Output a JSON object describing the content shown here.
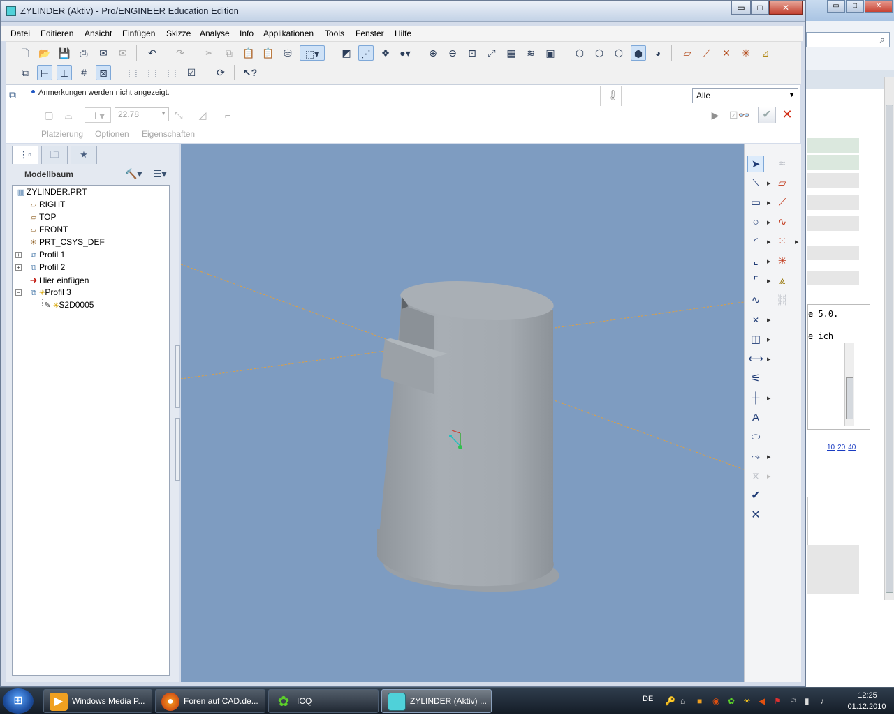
{
  "window": {
    "title": "ZYLINDER (Aktiv) - Pro/ENGINEER Education Edition",
    "min_glyph": "▭",
    "max_glyph": "□",
    "close_glyph": "✕"
  },
  "menu": [
    "Datei",
    "Editieren",
    "Ansicht",
    "Einfügen",
    "Skizze",
    "Analyse",
    "Info",
    "Applikationen",
    "Tools",
    "Fenster",
    "Hilfe"
  ],
  "dashboard": {
    "status_message": "Anmerkungen werden nicht angezeigt.",
    "filter_value": "Alle",
    "depth_value": "22.78",
    "tabs": [
      "Platzierung",
      "Optionen",
      "Eigenschaften"
    ]
  },
  "model_tree": {
    "header": "Modellbaum",
    "items": [
      {
        "label": "ZYLINDER.PRT",
        "icon": "part-icon"
      },
      {
        "label": "RIGHT",
        "icon": "datum-plane-icon"
      },
      {
        "label": "TOP",
        "icon": "datum-plane-icon"
      },
      {
        "label": "FRONT",
        "icon": "datum-plane-icon"
      },
      {
        "label": "PRT_CSYS_DEF",
        "icon": "coordinate-system-icon"
      },
      {
        "label": "Profil 1",
        "icon": "extrude-icon"
      },
      {
        "label": "Profil 2",
        "icon": "extrude-icon"
      },
      {
        "label": "Hier einfügen",
        "icon": "insert-here-arrow-icon"
      },
      {
        "label": "Profil 3",
        "icon": "extrude-icon"
      },
      {
        "label": "S2D0005",
        "icon": "sketch-icon"
      }
    ]
  },
  "background_window": {
    "code_lines": [
      "e 5.0.",
      "e ich"
    ],
    "pager": [
      "10",
      "20",
      "40"
    ]
  },
  "taskbar": {
    "items": [
      {
        "label": "Windows Media P...",
        "icon": "media-player-icon"
      },
      {
        "label": "Foren auf CAD.de...",
        "icon": "firefox-icon"
      },
      {
        "label": "ICQ",
        "icon": "icq-flower-icon"
      },
      {
        "label": "ZYLINDER (Aktiv) ...",
        "icon": "proe-icon"
      }
    ],
    "language": "DE",
    "time": "12:25",
    "date": "01.12.2010"
  },
  "colors": {
    "viewport_background": "#7e9cc1",
    "solid_surface": "#a5abb1",
    "datum_plane_edge": "#e0a040"
  }
}
